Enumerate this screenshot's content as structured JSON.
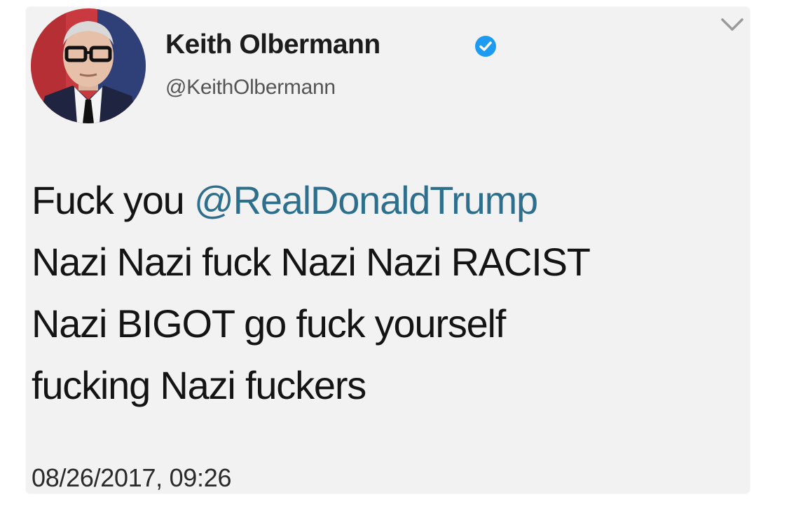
{
  "tweet": {
    "author": {
      "display_name": "Keith Olbermann",
      "handle": "@KeithOlbermann",
      "verified": true,
      "avatar_icon": "profile-photo-avatar"
    },
    "menu_icon": "chevron-down-icon",
    "body": {
      "line1_prefix": "Fuck you ",
      "line1_mention": "@RealDonaldTrump",
      "line2": "Nazi Nazi fuck Nazi Nazi RACIST",
      "line3": "Nazi BIGOT go fuck yourself",
      "line4": "fucking Nazi fuckers"
    },
    "timestamp": "08/26/2017, 09:26"
  },
  "colors": {
    "card_background": "#f2f2f2",
    "mention": "#2e6f8e",
    "verified_badge": "#1d9bf0",
    "text": "#141414"
  }
}
